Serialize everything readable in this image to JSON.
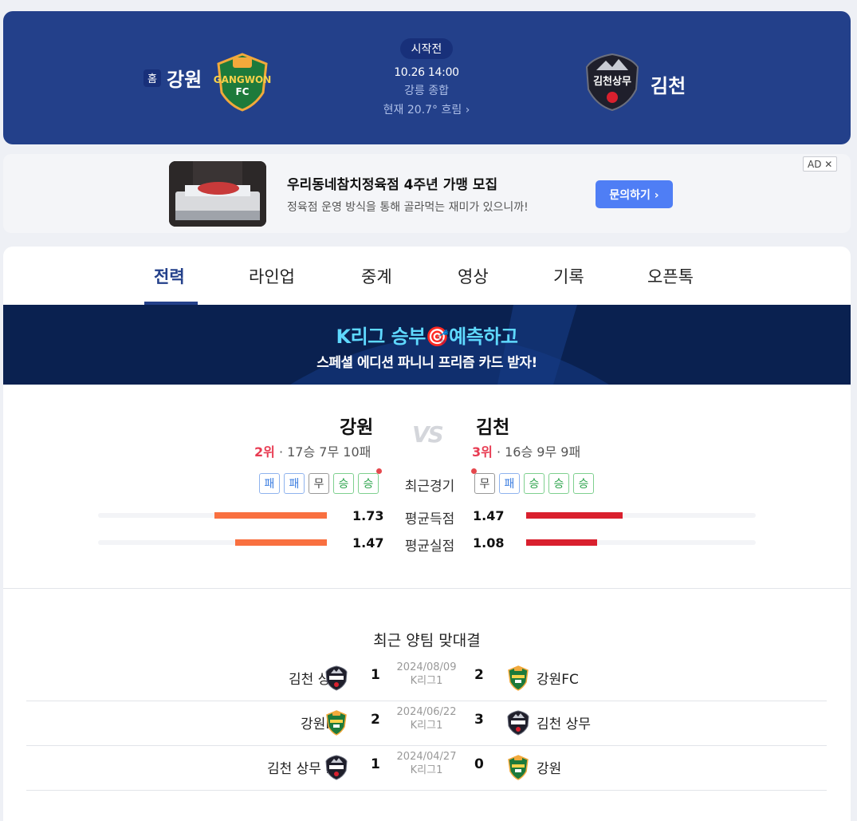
{
  "header": {
    "home_badge": "홈",
    "home_name": "강원",
    "away_name": "김천",
    "status": "시작전",
    "kickoff": "10.26 14:00",
    "venue": "강릉 종합",
    "weather": "현재 20.7° 흐림 ›"
  },
  "ad": {
    "title": "우리동네참치정육점 4주년 가맹 모집",
    "description": "정육점 운영 방식을 통해 골라먹는 재미가 있으니까!",
    "cta": "문의하기 ›",
    "label": "AD ✕"
  },
  "tabs": [
    "전력",
    "라인업",
    "중계",
    "영상",
    "기록",
    "오픈톡"
  ],
  "promo": {
    "line1": "K리그 승부🎯예측하고",
    "line2": "스페셜 에디션 파니니 프리즘 카드 받자!"
  },
  "compare": {
    "vs": "VS",
    "home": {
      "name": "강원",
      "rank": "2위",
      "record": " · 17승 7무 10패",
      "form": [
        "패",
        "패",
        "무",
        "승",
        "승"
      ],
      "avg_scored": "1.73",
      "avg_conceded": "1.47",
      "scored_bar_fraction": 0.49,
      "conceded_bar_fraction": 0.4
    },
    "away": {
      "name": "김천",
      "rank": "3위",
      "record": " · 16승 9무 9패",
      "form": [
        "무",
        "패",
        "승",
        "승",
        "승"
      ],
      "avg_scored": "1.47",
      "avg_conceded": "1.08",
      "scored_bar_fraction": 0.42,
      "conceded_bar_fraction": 0.31
    },
    "labels": {
      "recent": "최근경기",
      "avg_scored": "평균득점",
      "avg_conceded": "평균실점"
    },
    "colors": {
      "home_bar": "#f97040",
      "away_bar": "#d9202e"
    }
  },
  "h2h": {
    "title": "최근 양팀 맞대결",
    "matches": [
      {
        "left_team": "김천 상무",
        "left_crest": "gimcheon",
        "left_score": "1",
        "date": "2024/08/09",
        "league": "K리그1",
        "right_score": "2",
        "right_team": "강원FC",
        "right_crest": "gangwon"
      },
      {
        "left_team": "강원FC",
        "left_crest": "gangwon",
        "left_score": "2",
        "date": "2024/06/22",
        "league": "K리그1",
        "right_score": "3",
        "right_team": "김천 상무",
        "right_crest": "gimcheon"
      },
      {
        "left_team": "김천 상무 FC",
        "left_crest": "gimcheon",
        "left_score": "1",
        "date": "2024/04/27",
        "league": "K리그1",
        "right_score": "0",
        "right_team": "강원",
        "right_crest": "gangwon"
      }
    ]
  }
}
